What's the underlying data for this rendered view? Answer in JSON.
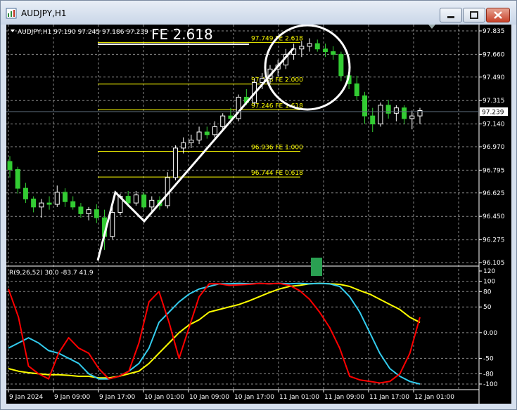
{
  "window": {
    "title": "AUDJPY,H1"
  },
  "chart_info": {
    "header": "AUDJPY,H1  97.190 97.245 97.186 97.239"
  },
  "annotation": {
    "label": "FE  2.618"
  },
  "fib_levels": [
    {
      "price": 97.749,
      "label": "97.749 FE 2.618"
    },
    {
      "price": 97.438,
      "label": "97.438 FE 2.000"
    },
    {
      "price": 97.246,
      "label": "97.246 FE 1.618"
    },
    {
      "price": 96.936,
      "label": "96.936 FE 1.000"
    },
    {
      "price": 96.744,
      "label": "96.744 FE 0.618"
    }
  ],
  "price_axis": [
    "97.835",
    "97.660",
    "97.490",
    "97.315",
    "97.140",
    "96.970",
    "96.795",
    "96.625",
    "96.450",
    "96.275",
    "96.105"
  ],
  "current_price": "97.239",
  "indicator": {
    "header": "R(9,26,52) 30.0 -83.7 41.9",
    "axis": [
      "120",
      "100",
      "80",
      "50",
      "0.00",
      "-50",
      "-80",
      "-100"
    ]
  },
  "time_axis": [
    "9 Jan 2024",
    "9 Jan 09:00",
    "9 Jan 17:00",
    "10 Jan 01:00",
    "10 Jan 09:00",
    "10 Jan 17:00",
    "11 Jan 01:00",
    "11 Jan 09:00",
    "11 Jan 17:00",
    "12 Jan 01:00"
  ],
  "colors": {
    "background": "#000000",
    "bull": "#ffffff",
    "bear": "#33cc33",
    "fib": "#ffff00",
    "fast": "#ff0000",
    "mid": "#33ccee",
    "slow": "#ffff00",
    "marker": "#2aa052"
  },
  "chart_data": {
    "type": "candlestick",
    "price_range": [
      96.105,
      97.835
    ],
    "indicator_range": [
      -100,
      120
    ],
    "candles": [
      [
        96.86,
        96.9,
        96.74,
        96.8
      ],
      [
        96.8,
        96.82,
        96.62,
        96.66
      ],
      [
        96.66,
        96.7,
        96.55,
        96.58
      ],
      [
        96.58,
        96.6,
        96.48,
        96.52
      ],
      [
        96.52,
        96.58,
        96.44,
        96.55
      ],
      [
        96.55,
        96.6,
        96.5,
        96.54
      ],
      [
        96.54,
        96.68,
        96.52,
        96.63
      ],
      [
        96.63,
        96.66,
        96.52,
        96.56
      ],
      [
        96.56,
        96.6,
        96.5,
        96.52
      ],
      [
        96.52,
        96.55,
        96.44,
        96.47
      ],
      [
        96.47,
        96.52,
        96.42,
        96.5
      ],
      [
        96.5,
        96.54,
        96.4,
        96.44
      ],
      [
        96.44,
        96.5,
        96.2,
        96.3
      ],
      [
        96.3,
        96.52,
        96.28,
        96.48
      ],
      [
        96.48,
        96.62,
        96.46,
        96.6
      ],
      [
        96.6,
        96.64,
        96.52,
        96.55
      ],
      [
        96.55,
        96.64,
        96.53,
        96.61
      ],
      [
        96.61,
        96.63,
        96.5,
        96.52
      ],
      [
        96.52,
        96.6,
        96.49,
        96.57
      ],
      [
        96.57,
        96.6,
        96.5,
        96.53
      ],
      [
        96.53,
        96.78,
        96.51,
        96.74
      ],
      [
        96.74,
        96.98,
        96.72,
        96.96
      ],
      [
        96.96,
        97.04,
        96.92,
        97.0
      ],
      [
        97.0,
        97.06,
        96.96,
        97.02
      ],
      [
        97.02,
        97.12,
        96.99,
        97.08
      ],
      [
        97.08,
        97.12,
        97.03,
        97.06
      ],
      [
        97.06,
        97.16,
        97.04,
        97.12
      ],
      [
        97.12,
        97.22,
        97.1,
        97.2
      ],
      [
        97.2,
        97.26,
        97.15,
        97.18
      ],
      [
        97.18,
        97.36,
        97.16,
        97.34
      ],
      [
        97.34,
        97.4,
        97.28,
        97.3
      ],
      [
        97.3,
        97.48,
        97.28,
        97.45
      ],
      [
        97.45,
        97.52,
        97.4,
        97.48
      ],
      [
        97.48,
        97.58,
        97.44,
        97.55
      ],
      [
        97.55,
        97.62,
        97.5,
        97.58
      ],
      [
        97.58,
        97.7,
        97.55,
        97.66
      ],
      [
        97.66,
        97.74,
        97.62,
        97.7
      ],
      [
        97.7,
        97.76,
        97.64,
        97.72
      ],
      [
        97.72,
        97.78,
        97.68,
        97.74
      ],
      [
        97.74,
        97.77,
        97.68,
        97.7
      ],
      [
        97.7,
        97.74,
        97.64,
        97.68
      ],
      [
        97.68,
        97.72,
        97.62,
        97.66
      ],
      [
        97.66,
        97.68,
        97.46,
        97.5
      ],
      [
        97.5,
        97.54,
        97.4,
        97.44
      ],
      [
        97.44,
        97.5,
        97.32,
        97.35
      ],
      [
        97.35,
        97.38,
        97.14,
        97.2
      ],
      [
        97.2,
        97.26,
        97.08,
        97.14
      ],
      [
        97.14,
        97.3,
        97.12,
        97.28
      ],
      [
        97.28,
        97.32,
        97.18,
        97.22
      ],
      [
        97.22,
        97.28,
        97.16,
        97.26
      ],
      [
        97.26,
        97.28,
        97.14,
        97.18
      ],
      [
        97.18,
        97.24,
        97.1,
        97.2
      ],
      [
        97.2,
        97.26,
        97.14,
        97.24
      ]
    ],
    "series": [
      {
        "name": "R fast",
        "values": [
          85,
          30,
          -65,
          -80,
          -90,
          -40,
          -10,
          -30,
          -40,
          -70,
          -90,
          -85,
          -75,
          -20,
          60,
          80,
          20,
          -50,
          10,
          70,
          95,
          95,
          92,
          93,
          94,
          96,
          95,
          96,
          92,
          82,
          65,
          40,
          10,
          -30,
          -85,
          -92,
          -95,
          -98,
          -95,
          -80,
          -40,
          30
        ]
      },
      {
        "name": "R mid",
        "values": [
          -30,
          -20,
          -10,
          -20,
          -35,
          -40,
          -50,
          -60,
          -80,
          -90,
          -90,
          -85,
          -75,
          -60,
          -30,
          20,
          40,
          60,
          75,
          85,
          90,
          95,
          95,
          96,
          95,
          96,
          95,
          96,
          95,
          96,
          95,
          96,
          95,
          90,
          70,
          40,
          0,
          -40,
          -70,
          -85,
          -95,
          -100
        ]
      },
      {
        "name": "R slow",
        "values": [
          -70,
          -75,
          -78,
          -80,
          -82,
          -82,
          -83,
          -85,
          -85,
          -88,
          -88,
          -85,
          -80,
          -75,
          -60,
          -40,
          -20,
          0,
          15,
          25,
          40,
          45,
          50,
          55,
          62,
          70,
          78,
          85,
          90,
          92,
          95,
          96,
          95,
          94,
          90,
          82,
          75,
          65,
          55,
          45,
          30,
          20
        ]
      }
    ]
  }
}
